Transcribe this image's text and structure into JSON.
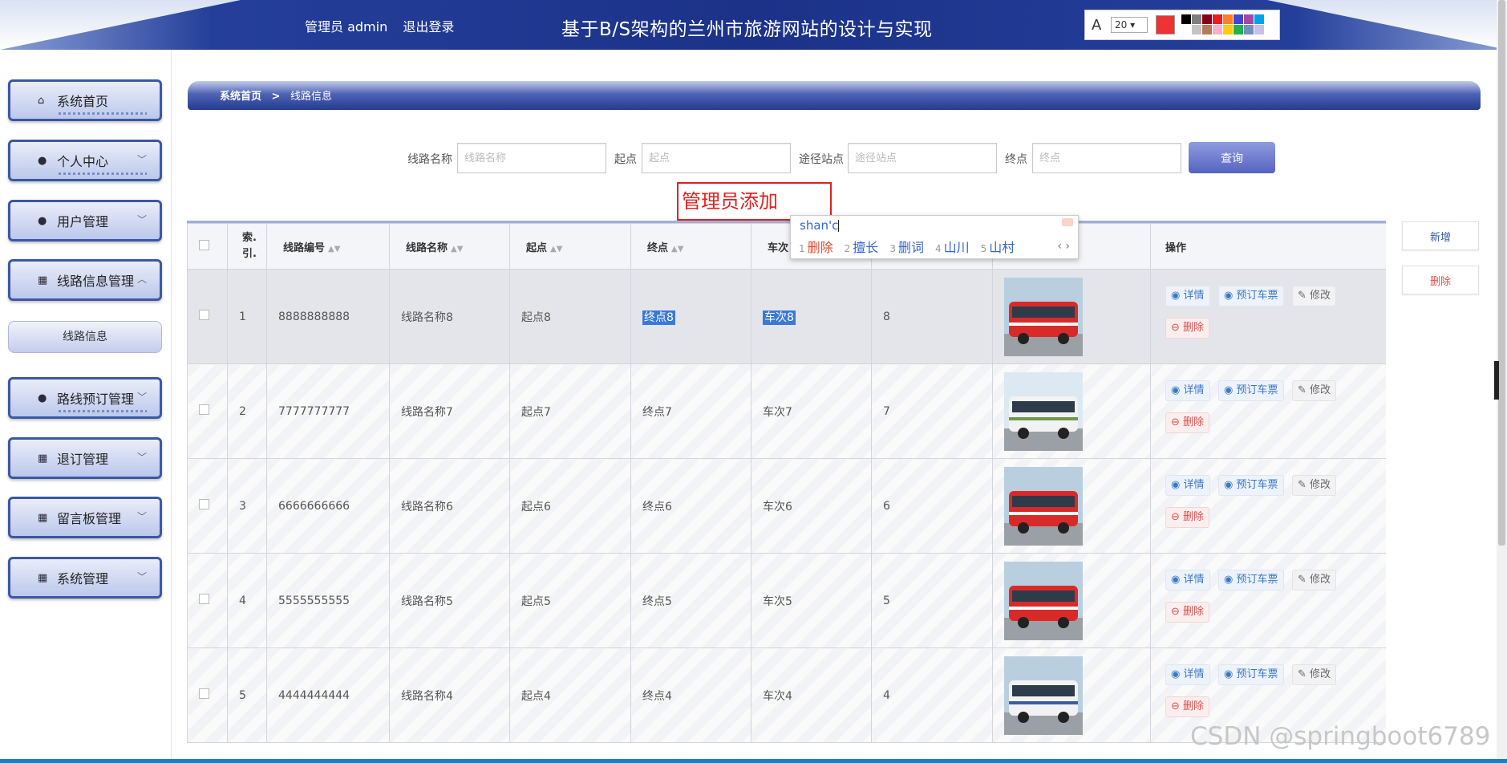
{
  "header": {
    "user_label": "管理员 admin",
    "logout_label": "退出登录",
    "title": "基于B/S架构的兰州市旅游网站的设计与实现"
  },
  "draw_toolbar": {
    "font_size": "20",
    "current_color": "#ee3333",
    "swatches": [
      "#000000",
      "#7f7f7f",
      "#880015",
      "#ed1c24",
      "#ff7f27",
      "#3f48cc",
      "#a349a4",
      "#00a2e8",
      "#ffffff",
      "#c3c3c3",
      "#b97a57",
      "#ffaec9",
      "#ffc90e",
      "#22b14c",
      "#7092be",
      "#c8bfe7"
    ]
  },
  "sidebar": {
    "items": [
      {
        "label": "系统首页",
        "icon": "home-icon",
        "expandable": false
      },
      {
        "label": "个人中心",
        "icon": "user-icon",
        "expandable": true
      },
      {
        "label": "用户管理",
        "icon": "user-icon",
        "expandable": true
      },
      {
        "label": "线路信息管理",
        "icon": "grid-icon",
        "expandable": true,
        "expanded": true
      },
      {
        "label": "路线预订管理",
        "icon": "user-icon",
        "expandable": true
      },
      {
        "label": "退订管理",
        "icon": "grid-icon",
        "expandable": true
      },
      {
        "label": "留言板管理",
        "icon": "grid-icon",
        "expandable": true
      },
      {
        "label": "系统管理",
        "icon": "grid-icon",
        "expandable": true
      }
    ],
    "sub_item": "线路信息"
  },
  "breadcrumb": {
    "home": "系统首页",
    "separator": ">",
    "current": "线路信息"
  },
  "search": {
    "route_name_label": "线路名称",
    "route_name_placeholder": "线路名称",
    "start_label": "起点",
    "start_placeholder": "起点",
    "via_label": "途径站点",
    "via_placeholder": "途径站点",
    "end_label": "终点",
    "end_placeholder": "终点",
    "query_label": "查询"
  },
  "annotation": "管理员添加",
  "ime": {
    "typed": "shan'c",
    "candidates": [
      {
        "n": "1",
        "text": "删除"
      },
      {
        "n": "2",
        "text": "擅长"
      },
      {
        "n": "3",
        "text": "删词"
      },
      {
        "n": "4",
        "text": "山川"
      },
      {
        "n": "5",
        "text": "山村"
      }
    ],
    "nav": "‹ ›"
  },
  "table": {
    "headers": {
      "index_line1": "索.",
      "index_line2": "引.",
      "route_no": "线路编号",
      "route_name": "线路名称",
      "start": "起点",
      "end": "终点",
      "train": "车次",
      "ops": "操作"
    },
    "ops": {
      "detail": "详情",
      "book": "预订车票",
      "edit": "修改",
      "delete": "删除"
    },
    "rows": [
      {
        "index": "1",
        "route_no": "8888888888",
        "route_name": "线路名称8",
        "start": "起点8",
        "end": "终点8",
        "train": "车次8",
        "value": "8",
        "image": "red-bus"
      },
      {
        "index": "2",
        "route_no": "7777777777",
        "route_name": "线路名称7",
        "start": "起点7",
        "end": "终点7",
        "train": "车次7",
        "value": "7",
        "image": "white-minibus"
      },
      {
        "index": "3",
        "route_no": "6666666666",
        "route_name": "线路名称6",
        "start": "起点6",
        "end": "终点6",
        "train": "车次6",
        "value": "6",
        "image": "red-bus"
      },
      {
        "index": "4",
        "route_no": "5555555555",
        "route_name": "线路名称5",
        "start": "起点5",
        "end": "终点5",
        "train": "车次5",
        "value": "5",
        "image": "red-bus"
      },
      {
        "index": "5",
        "route_no": "4444444444",
        "route_name": "线路名称4",
        "start": "起点4",
        "end": "终点4",
        "train": "车次4",
        "value": "4",
        "image": "white-coach"
      }
    ]
  },
  "side_actions": {
    "add_label": "新增",
    "delete_label": "删除"
  },
  "watermark": "CSDN @springboot6789"
}
